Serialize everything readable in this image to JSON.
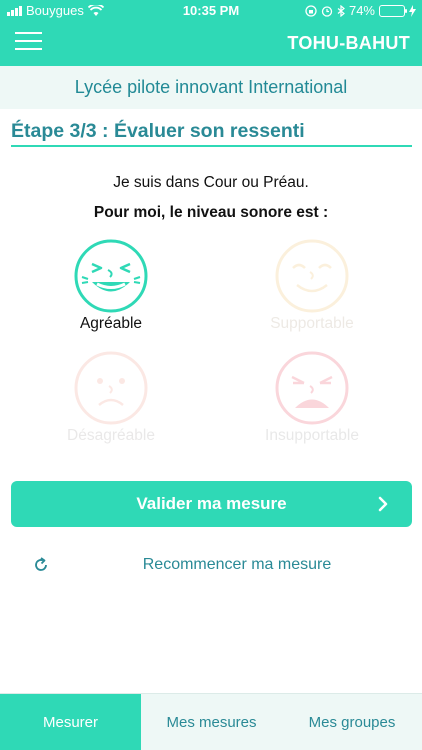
{
  "status_bar": {
    "carrier": "Bouygues",
    "time": "10:35 PM",
    "battery": "74%",
    "battery_level": 0.74
  },
  "header": {
    "app_title": "TOHU-BAHUT"
  },
  "school": {
    "name": "Lycée pilote innovant International"
  },
  "step": {
    "title": "Étape 3/3 : Évaluer son ressenti"
  },
  "prompt": {
    "location": "Je suis dans Cour ou Préau.",
    "question": "Pour moi, le niveau sonore est :"
  },
  "ratings": [
    {
      "label": "Agréable",
      "selected": true,
      "color": "#2fd9b6"
    },
    {
      "label": "Supportable",
      "selected": false,
      "color": "#f0bd63"
    },
    {
      "label": "Désagréable",
      "selected": false,
      "color": "#f09a86"
    },
    {
      "label": "Insupportable",
      "selected": false,
      "color": "#ea4b60"
    }
  ],
  "actions": {
    "validate": "Valider ma mesure",
    "restart": "Recommencer ma mesure"
  },
  "tabs": [
    {
      "label": "Mesurer",
      "active": true
    },
    {
      "label": "Mes mesures",
      "active": false
    },
    {
      "label": "Mes groupes",
      "active": false
    }
  ],
  "colors": {
    "accent": "#2fd9b6",
    "teal_text": "#2a8a96",
    "band_bg": "#eef8f6"
  }
}
